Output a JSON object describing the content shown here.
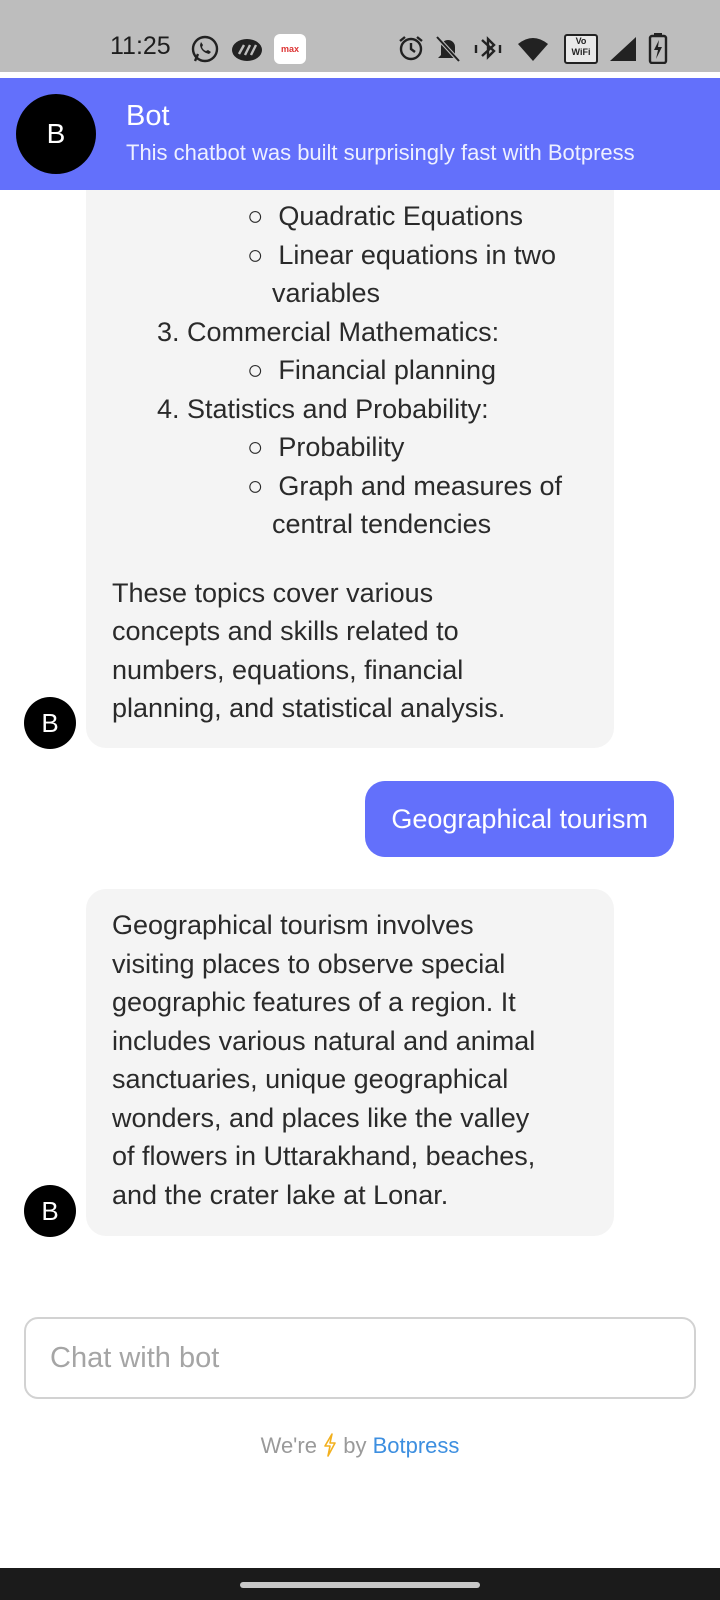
{
  "status_bar": {
    "time": "11:25",
    "left_icons": [
      "whatsapp-icon",
      "app-logo-icon",
      "max-app-icon"
    ],
    "right_icons": [
      "alarm-icon",
      "mute-icon",
      "bluetooth-vibrate-icon",
      "wifi-icon",
      "vowifi-icon",
      "signal-icon",
      "battery-charging-icon"
    ],
    "max_label": "max",
    "vowifi_label": "Vo WiFi"
  },
  "header": {
    "avatar_letter": "B",
    "title": "Bot",
    "subtitle": "This chatbot was built surprisingly fast with Botpress"
  },
  "messages": {
    "bot1": {
      "avatar": "B",
      "lines": [
        "Quadratic Equations",
        "Linear equations in two",
        "variables",
        "3. Commercial Mathematics:",
        "Financial planning",
        "4. Statistics and Probability:",
        "Probability",
        "Graph and measures of",
        "central tendencies"
      ],
      "summary": [
        "These topics cover various",
        "concepts and skills related to",
        "numbers, equations, financial",
        "planning, and statistical analysis."
      ]
    },
    "user1": {
      "text": "Geographical tourism"
    },
    "bot2": {
      "avatar": "B",
      "lines": [
        "Geographical tourism involves",
        "visiting places to observe special",
        "geographic features of a region. It",
        "includes various natural and animal",
        "sanctuaries, unique geographical",
        "wonders, and places like the valley",
        "of flowers in Uttarakhand, beaches,",
        "and the crater lake at Lonar."
      ]
    }
  },
  "composer": {
    "placeholder": "Chat with bot",
    "value": ""
  },
  "footer": {
    "prefix": "We're",
    "icon": "lightning-icon",
    "middle": "by",
    "brand": "Botpress"
  },
  "bullet": "○"
}
